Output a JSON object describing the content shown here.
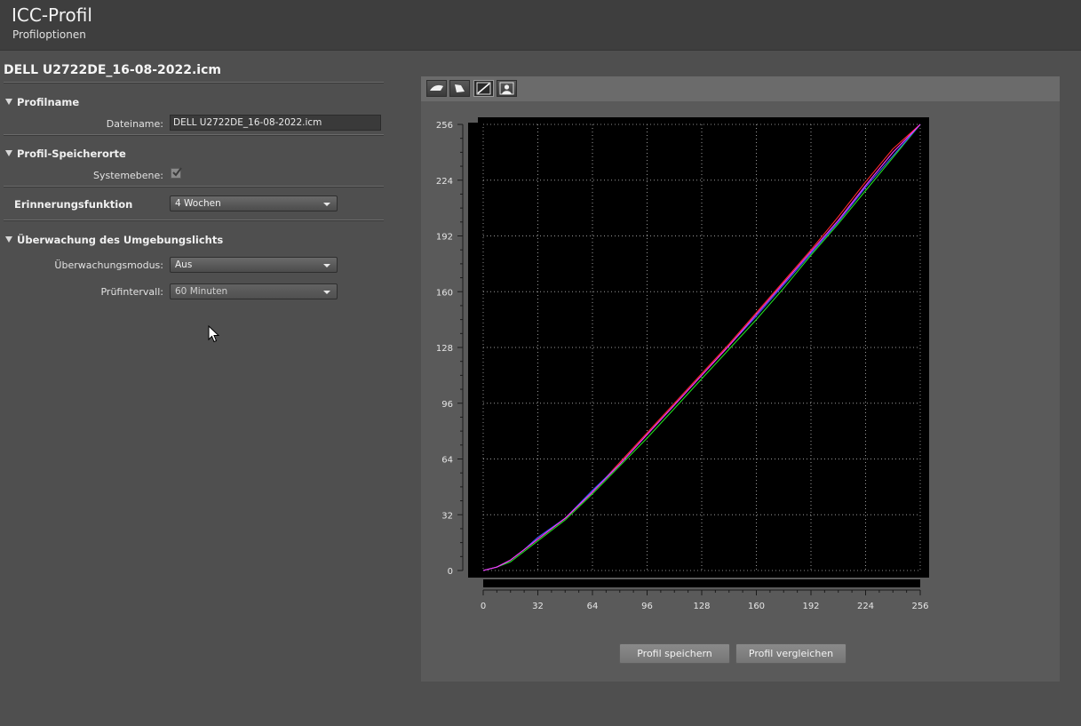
{
  "header": {
    "title": "ICC-Profil",
    "subtitle": "Profiloptionen"
  },
  "profile": {
    "file_name": "DELL U2722DE_16-08-2022.icm",
    "sections": {
      "profile_name": {
        "title": "Profilname",
        "filename_label": "Dateiname:",
        "filename_value": "DELL U2722DE_16-08-2022.icm"
      },
      "storage": {
        "title": "Profil-Speicherorte",
        "system_label": "Systemebene:",
        "system_checked": true
      },
      "reminder": {
        "title": "Erinnerungsfunktion",
        "value": "4 Wochen"
      },
      "ambient": {
        "title": "Überwachung des Umgebungslichts",
        "mode_label": "Überwachungsmodus:",
        "mode_value": "Aus",
        "interval_label": "Prüfintervall:",
        "interval_value": "60 Minuten"
      }
    }
  },
  "toolbar": {
    "buttons": [
      {
        "icon": "gamut-2d-icon"
      },
      {
        "icon": "gamut-3d-icon"
      },
      {
        "icon": "tone-curve-icon",
        "active": true
      },
      {
        "icon": "image-preview-icon"
      }
    ]
  },
  "chart_data": {
    "type": "line",
    "title": "",
    "xlabel": "",
    "ylabel": "",
    "xlim": [
      0,
      256
    ],
    "ylim": [
      0,
      256
    ],
    "x_ticks": [
      "0",
      "32",
      "64",
      "96",
      "128",
      "160",
      "192",
      "224",
      "256"
    ],
    "y_ticks": [
      "0",
      "32",
      "64",
      "96",
      "128",
      "160",
      "192",
      "224",
      "256"
    ],
    "grid": true,
    "background": "#000000",
    "series": [
      {
        "color": "#ff2a2a",
        "x": [
          0,
          8,
          16,
          24,
          32,
          48,
          64,
          80,
          96,
          112,
          128,
          144,
          160,
          176,
          192,
          208,
          224,
          240,
          256
        ],
        "y": [
          0,
          2,
          6,
          12,
          18,
          30,
          45,
          62,
          79,
          96,
          113,
          130,
          148,
          166,
          184,
          203,
          223,
          242,
          261
        ]
      },
      {
        "color": "#22dd22",
        "x": [
          0,
          8,
          16,
          24,
          32,
          48,
          64,
          80,
          96,
          112,
          128,
          144,
          160,
          176,
          192,
          208,
          224,
          240,
          256
        ],
        "y": [
          0,
          2,
          5,
          11,
          17,
          29,
          44,
          60,
          76,
          93,
          110,
          127,
          144,
          162,
          181,
          199,
          218,
          237,
          256
        ]
      },
      {
        "color": "#3a5cff",
        "x": [
          0,
          8,
          16,
          24,
          32,
          48,
          64,
          80,
          96,
          112,
          128,
          144,
          160,
          176,
          192,
          208,
          224,
          240,
          256
        ],
        "y": [
          0,
          2,
          6,
          12,
          19,
          30,
          46,
          61,
          78,
          95,
          112,
          129,
          146,
          164,
          182,
          200,
          220,
          238,
          257
        ]
      },
      {
        "color": "#ff33ff",
        "x": [
          0,
          8,
          16,
          24,
          32,
          48,
          64,
          80,
          96,
          112,
          128,
          144,
          160,
          176,
          192,
          208,
          224,
          240,
          256
        ],
        "y": [
          0,
          2,
          6,
          12,
          18,
          30,
          45,
          61,
          78,
          95,
          112,
          129,
          147,
          165,
          183,
          201,
          221,
          240,
          258
        ]
      }
    ]
  },
  "actions": {
    "save_label": "Profil speichern",
    "compare_label": "Profil vergleichen"
  }
}
